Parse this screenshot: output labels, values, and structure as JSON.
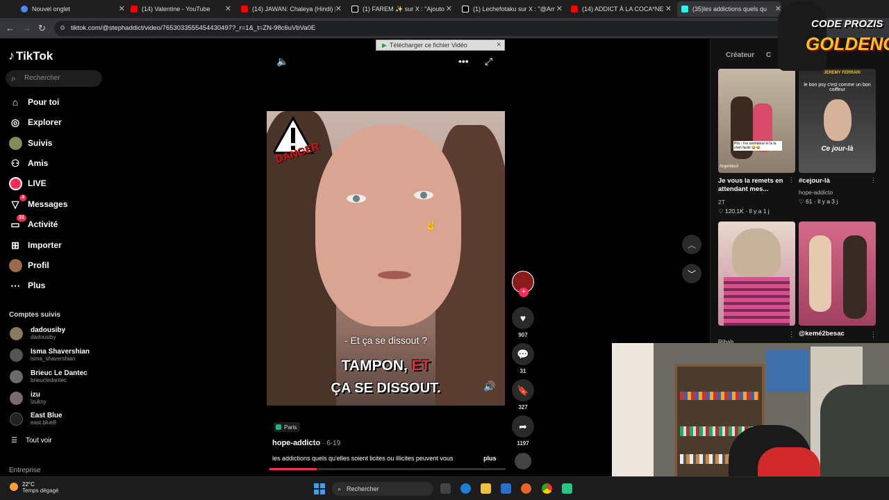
{
  "browser": {
    "tabs": [
      {
        "label": "Nouvel onglet",
        "color": "#4a8af4"
      },
      {
        "label": "(14) Valentine - YouTube",
        "color": "#ff0000"
      },
      {
        "label": "(14) JAWAN: Chaleya (Hindi) | S",
        "color": "#ff0000"
      },
      {
        "label": "(1) FAREM ✨ sur X : \"Ajouton",
        "color": "#ffffff"
      },
      {
        "label": "(1) Lechefotaku sur X : \"@Ama",
        "color": "#ffffff"
      },
      {
        "label": "(14) ADDICT À LA COCA*NE : A",
        "color": "#ff0000"
      },
      {
        "label": "(35)les addictions quels qu",
        "color": "#25f4ee"
      }
    ],
    "url": "tiktok.com/@stephaddict/video/7653033555454430497?_r=1&_t=ZN-98c6uVbVa0E",
    "download_bar": "Télécharger ce fichier Vidéo"
  },
  "tiktok": {
    "logo": "TikTok",
    "search_placeholder": "Rechercher",
    "nav": [
      {
        "label": "Pour toi",
        "icon": "home-icon",
        "glyph": "⌂"
      },
      {
        "label": "Explorer",
        "icon": "compass-icon",
        "glyph": "◎"
      },
      {
        "label": "Suivis",
        "icon": "avatar-icon",
        "glyph": ""
      },
      {
        "label": "Amis",
        "icon": "friends-icon",
        "glyph": "👥"
      },
      {
        "label": "LIVE",
        "icon": "live-icon",
        "glyph": ""
      },
      {
        "label": "Messages",
        "icon": "messages-icon",
        "glyph": "▽",
        "badge": "4"
      },
      {
        "label": "Activité",
        "icon": "activity-icon",
        "glyph": "▭",
        "badge": "31"
      },
      {
        "label": "Importer",
        "icon": "upload-icon",
        "glyph": "⊞"
      },
      {
        "label": "Profil",
        "icon": "profile-icon",
        "glyph": ""
      },
      {
        "label": "Plus",
        "icon": "more-icon",
        "glyph": "⋯"
      }
    ],
    "followed_title": "Comptes suivis",
    "followed": [
      {
        "name": "dadousiby",
        "handle": "dadousiby",
        "color": "#8a7a60"
      },
      {
        "name": "Isma Shavershian",
        "handle": "isma_shavershian",
        "color": "#555"
      },
      {
        "name": "Brieuc Le Dantec",
        "handle": "brieucledantec",
        "color": "#6b6b6b"
      },
      {
        "name": "izu",
        "handle": "izukny",
        "color": "#7a6a6a"
      },
      {
        "name": "East Blue",
        "handle": "east.blue8",
        "color": "#222"
      }
    ],
    "see_all": "Tout voir",
    "enterprise": "Entreprise"
  },
  "video": {
    "overlay_danger": "DANGER",
    "subtitle_question": "- Et ça se dissout ?",
    "subtitle_line1_a": "TAMPON,",
    "subtitle_line1_b": "ET",
    "subtitle_line2": "ÇA SE DISSOUT.",
    "likes": "907",
    "comments": "31",
    "saves": "327",
    "shares": "1197",
    "location": "Paris",
    "author": "hope-addicto",
    "date": "· 6-19",
    "description": "les addictions quels qu'elles soient licites ou illicites peuvent vous",
    "more": "plus",
    "progress_fraction": 0.2
  },
  "right_panel": {
    "tabs": [
      "Créateur",
      "C"
    ],
    "cards": [
      {
        "caption": "Je vous la remets en attendant mes...",
        "author": "2T",
        "stats": "♡ 120.1K · Il y a 1 j",
        "overlay": "Pov : t'es animateur et ta la cheh facile 😂😂",
        "overlay2": "Argenteuil"
      },
      {
        "caption": "#cejour-là",
        "author": "hope-addicto",
        "stats": "♡ 61 · Il y a 3 j",
        "overlay": "le bon psy c'est comme un bon coiffeur",
        "overlay2": "Ce jour-là",
        "overlay3": "JEREMY FERRARI"
      },
      {
        "caption": "Rihab",
        "author": "",
        "stats": ""
      },
      {
        "caption": "@kemé2besac",
        "author": "",
        "stats": ""
      }
    ]
  },
  "stream_overlay": {
    "line1": "CODE PROZIS",
    "line2": "GOLDENG"
  },
  "taskbar": {
    "temp": "22°C",
    "weather": "Temps dégagé",
    "search": "Rechercher"
  }
}
